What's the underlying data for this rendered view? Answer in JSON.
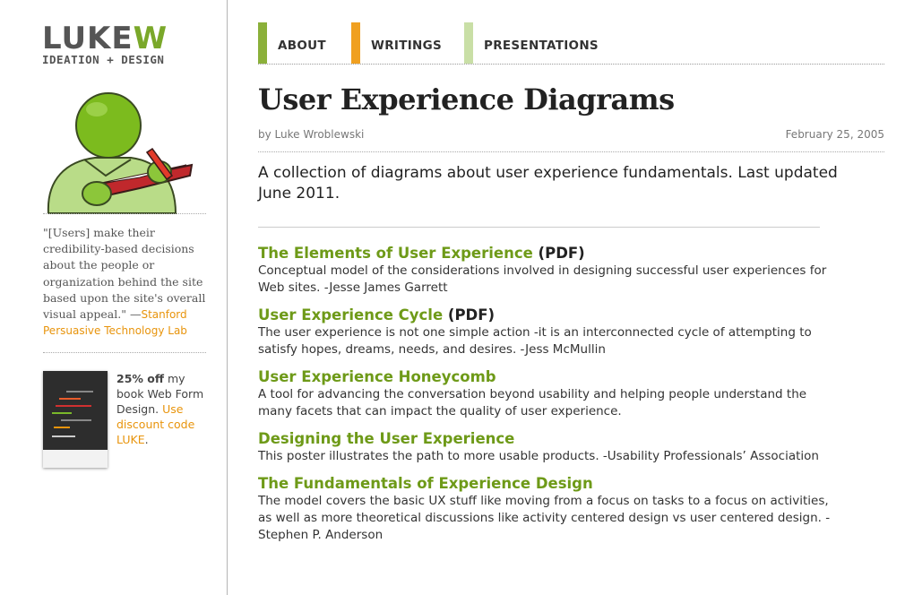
{
  "logo": {
    "main_a": "LUKE",
    "main_b": "W",
    "tagline": "IDEATION + DESIGN"
  },
  "quote": {
    "text": "\"[Users] make their credibility-based decisions about the people or organization behind the site based upon the site's overall visual appeal.\" —",
    "source": "Stanford Persuasive Technology Lab"
  },
  "promo": {
    "discount": "25% off",
    "text": " my book Web Form Design. ",
    "code_text": "Use discount code LUKE",
    "end": "."
  },
  "nav": {
    "tabs": [
      {
        "label": "ABOUT",
        "color": "#8bb03a"
      },
      {
        "label": "WRITINGS",
        "color": "#f0a020"
      },
      {
        "label": "PRESENTATIONS",
        "color": "#c9dfa6"
      }
    ]
  },
  "article": {
    "title": "User Experience Diagrams",
    "author": "by Luke Wroblewski",
    "date": "February 25, 2005",
    "intro": "A collection of diagrams about user experience fundamentals. Last updated June 2011."
  },
  "items": [
    {
      "title": "The Elements of User Experience",
      "pdf": " (PDF)",
      "desc": "Conceptual model of the considerations involved in designing successful user experiences for Web sites. -Jesse James Garrett"
    },
    {
      "title": "User Experience Cycle",
      "pdf": " (PDF)",
      "desc": "The user experience is not one simple action -it is an interconnected cycle of attempting to satisfy hopes, dreams, needs, and desires. -Jess McMullin"
    },
    {
      "title": "User Experience Honeycomb",
      "pdf": "",
      "desc": "A tool for advancing the conversation beyond usability and helping people understand the many facets that can impact the quality of user experience."
    },
    {
      "title": "Designing the User Experience",
      "pdf": "",
      "desc": "This poster illustrates the path to more usable products. -Usability Professionals’ Association"
    },
    {
      "title": "The Fundamentals of Experience Design",
      "pdf": "",
      "desc": "The model covers the basic UX stuff like moving from a focus on tasks to a focus on activities, as well as more theoretical discussions like activity centered design vs user centered design. -Stephen P. Anderson"
    }
  ]
}
